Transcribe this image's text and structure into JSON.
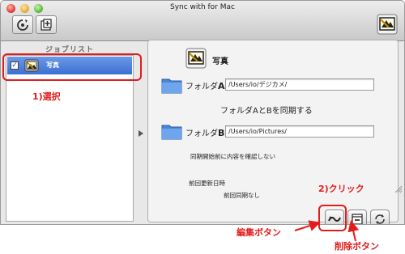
{
  "window": {
    "title": "Sync with for Mac"
  },
  "sidebar": {
    "header": "ジョブリスト",
    "items": [
      {
        "label": "写真",
        "checked": true
      }
    ]
  },
  "detail": {
    "job_name": "写真",
    "folder_a": {
      "label_prefix": "フォルダ",
      "letter": "A",
      "path": "/Users/io/デジカメ/"
    },
    "sync_statement": "フォルダAとBを同期する",
    "folder_b": {
      "label_prefix": "フォルダ",
      "letter": "B",
      "path": "/Users/io/Pictures/"
    },
    "confirm_text": "同期開始前に内容を確認しない",
    "last_sync_label": "前回更新日時",
    "last_sync_value": "前回同期なし"
  },
  "annotations": {
    "select": "1)選択",
    "click": "2)クリック",
    "edit_button": "編集ボタン",
    "delete_button": "削除ボタン",
    "color": "#e31b1b"
  },
  "colors": {
    "selection": "#3a6fd3",
    "folder": "#4a86d6"
  },
  "icons": [
    "refresh-icon",
    "new-job-icon",
    "sync-app-icon",
    "photo-job-icon",
    "folder-icon",
    "edit-icon",
    "delete-icon",
    "sync-icon"
  ]
}
